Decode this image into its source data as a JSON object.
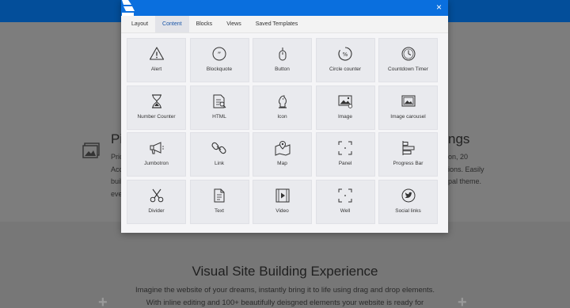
{
  "background": {
    "heading_left": "Pi",
    "text_left": [
      "Pric",
      "Acc",
      "buil",
      "eve"
    ],
    "heading_right": "ngs",
    "text_right": [
      "on, 20",
      "ions. Easily",
      "pal theme."
    ],
    "section_title": "Visual Site Building Experience",
    "section_text_1": "Imagine the website of your dreams, instantly bring it to life using drag and drop elements.",
    "section_text_2": "With inline editing and 100+ beautifully deisgned elements your website is ready for"
  },
  "modal": {
    "close_label": "×",
    "tabs": [
      {
        "label": "Layout",
        "active": false
      },
      {
        "label": "Content",
        "active": true
      },
      {
        "label": "Blocks",
        "active": false
      },
      {
        "label": "Views",
        "active": false
      },
      {
        "label": "Saved Templates",
        "active": false
      }
    ],
    "elements": [
      {
        "label": "Alert",
        "icon": "alert-icon"
      },
      {
        "label": "Blockquote",
        "icon": "blockquote-icon"
      },
      {
        "label": "Button",
        "icon": "button-icon"
      },
      {
        "label": "Circle counter",
        "icon": "circle-counter-icon"
      },
      {
        "label": "Countdown Timer",
        "icon": "countdown-timer-icon"
      },
      {
        "label": "Number Counter",
        "icon": "number-counter-icon"
      },
      {
        "label": "HTML",
        "icon": "html-icon"
      },
      {
        "label": "Icon",
        "icon": "icon-icon"
      },
      {
        "label": "Image",
        "icon": "image-icon"
      },
      {
        "label": "Image carousel",
        "icon": "image-carousel-icon"
      },
      {
        "label": "Jumbotron",
        "icon": "jumbotron-icon"
      },
      {
        "label": "Link",
        "icon": "link-icon"
      },
      {
        "label": "Map",
        "icon": "map-icon"
      },
      {
        "label": "Panel",
        "icon": "panel-icon"
      },
      {
        "label": "Progress Bar",
        "icon": "progress-bar-icon"
      },
      {
        "label": "Divider",
        "icon": "divider-icon"
      },
      {
        "label": "Text",
        "icon": "text-icon"
      },
      {
        "label": "Video",
        "icon": "video-icon"
      },
      {
        "label": "Well",
        "icon": "well-icon"
      },
      {
        "label": "Social links",
        "icon": "social-links-icon"
      }
    ]
  },
  "colors": {
    "header_blue": "#0a6fde",
    "active_tab_text": "#1a56a8",
    "tile_bg": "#e9eaee"
  }
}
